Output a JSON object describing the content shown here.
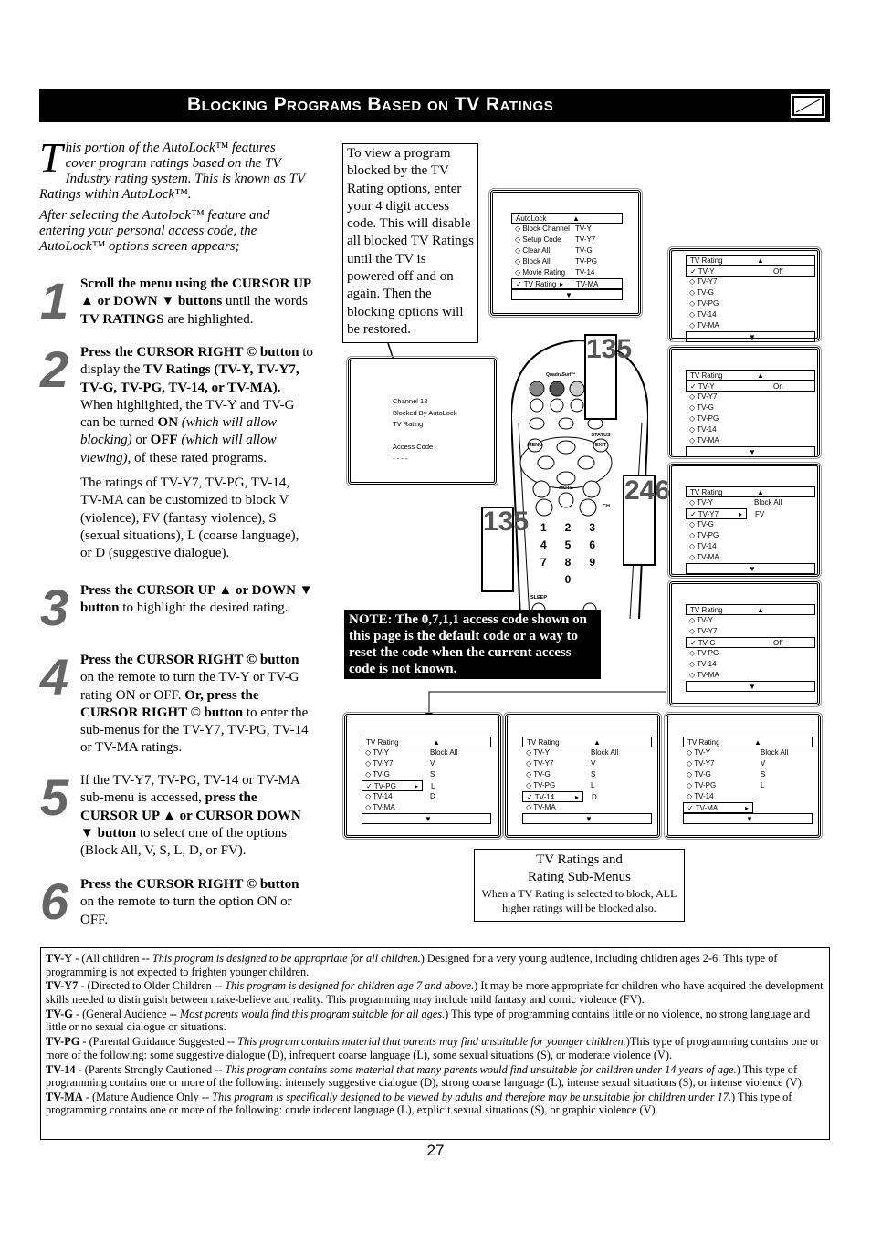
{
  "header": {
    "title": "Blocking Programs Based on TV Ratings",
    "icon": "tv-screen-icon"
  },
  "intro": {
    "dropcap": "T",
    "p1": "his portion of the AutoLock™ features cover program ratings based on the TV Industry rating system. This is known as TV Ratings within AutoLock™.",
    "p2": "After selecting the Autolock™ feature and entering your personal access code, the AutoLock™ options screen appears;"
  },
  "steps": [
    {
      "num": "1",
      "paras": [
        [
          {
            "t": "Scroll the menu using the CURSOR UP ▲ or DOWN ▼ buttons",
            "s": "b"
          },
          {
            "t": " until the words "
          },
          {
            "t": "TV RATINGS",
            "s": "b"
          },
          {
            "t": " are highlighted."
          }
        ]
      ]
    },
    {
      "num": "2",
      "paras": [
        [
          {
            "t": "Press the CURSOR RIGHT © but­ton",
            "s": "b"
          },
          {
            "t": " to display the "
          },
          {
            "t": "TV Ratings (TV-Y, TV-Y7, TV-G, TV-PG, TV-14, or TV-MA).",
            "s": "b"
          },
          {
            "t": " When highlighted, the TV-Y and TV-G can be turned "
          },
          {
            "t": "ON",
            "s": "b"
          },
          {
            "t": " (which will allow blocking)",
            "s": "i"
          },
          {
            "t": " or "
          },
          {
            "t": "OFF",
            "s": "b"
          },
          {
            "t": " (which will allow viewing)",
            "s": "i"
          },
          {
            "t": ", of these rated pro­grams."
          }
        ],
        [
          {
            "t": "The ratings of TV-Y7, TV-PG, TV-14, TV-MA can be customized to block V (violence), FV (fantasy violence), S (sexual situations), L (coarse lan­guage), or D (suggestive dialogue)."
          }
        ]
      ]
    },
    {
      "num": "3",
      "paras": [
        [
          {
            "t": "Press the CURSOR UP ▲ or DOWN ▼ button",
            "s": "b"
          },
          {
            "t": " to highlight the desired rat­ing."
          }
        ]
      ]
    },
    {
      "num": "4",
      "paras": [
        [
          {
            "t": "Press the CURSOR RIGHT © but­ton",
            "s": "b"
          },
          {
            "t": " on the remote to turn the TV-Y or TV-G rating ON or OFF. "
          },
          {
            "t": "Or, press the CURSOR RIGHT © button",
            "s": "b"
          },
          {
            "t": " to enter the sub-menus for the TV-Y7, TV-PG, TV-14 or TV-MA ratings."
          }
        ]
      ]
    },
    {
      "num": "5",
      "paras": [
        [
          {
            "t": "If the TV-Y7, TV-PG, TV-14 or TV-MA sub-menu is accessed, "
          },
          {
            "t": "press the CURSOR UP ▲ or CURSOR DOWN ▼ button",
            "s": "b"
          },
          {
            "t": " to select one of the options (Block All, V, S, L, D, or FV)."
          }
        ]
      ]
    },
    {
      "num": "6",
      "paras": [
        [
          {
            "t": "Press the CURSOR RIGHT © but­ton",
            "s": "b"
          },
          {
            "t": " on the remote to turn the option ON or OFF."
          }
        ]
      ]
    }
  ],
  "callout": "To view a program blocked by the TV Rating options, enter your 4 digit access code. This will dis­able all blocked TV Ratings until the TV is powered off and on again. Then the blocking options will be restored.",
  "blocked_screen": [
    "Channel 12",
    "Blocked By AutoLock",
    "TV Rating",
    "",
    "Access Code",
    "- - - -"
  ],
  "remote": {
    "brand": "QuadraSurf™",
    "buttons": [
      "MENU",
      "STATUS",
      "EXIT",
      "MUTE",
      "CH",
      "SLEEP"
    ],
    "digits": [
      "1",
      "2",
      "3",
      "4",
      "5",
      "6",
      "7",
      "8",
      "9",
      "0"
    ],
    "callouts": [
      "135",
      "246",
      "135"
    ]
  },
  "screens": [
    {
      "id": "autolock",
      "title": "AutoLock",
      "sel": 5,
      "rows": [
        [
          "Block Channel",
          "TV-Y"
        ],
        [
          "Setup Code",
          "TV-Y7"
        ],
        [
          "Clear All",
          "TV-G"
        ],
        [
          "Block All",
          "TV-PG"
        ],
        [
          "Movie Rating",
          "TV-14"
        ],
        [
          "TV Rating",
          "TV-MA"
        ]
      ]
    },
    {
      "id": "r1",
      "title": "TV Rating",
      "sel": 0,
      "rows": [
        [
          "TV-Y",
          "Off"
        ],
        [
          "TV-Y7",
          ""
        ],
        [
          "TV-G",
          ""
        ],
        [
          "TV-PG",
          ""
        ],
        [
          "TV-14",
          ""
        ],
        [
          "TV-MA",
          ""
        ]
      ]
    },
    {
      "id": "r2",
      "title": "TV Rating",
      "sel": 0,
      "rows": [
        [
          "TV-Y",
          "On"
        ],
        [
          "TV-Y7",
          ""
        ],
        [
          "TV-G",
          ""
        ],
        [
          "TV-PG",
          ""
        ],
        [
          "TV-14",
          ""
        ],
        [
          "TV-MA",
          ""
        ]
      ]
    },
    {
      "id": "r3",
      "title": "TV Rating",
      "sel": 1,
      "rows": [
        [
          "TV-Y",
          "Block All"
        ],
        [
          "TV-Y7",
          "FV"
        ],
        [
          "TV-G",
          ""
        ],
        [
          "TV-PG",
          ""
        ],
        [
          "TV-14",
          ""
        ],
        [
          "TV-MA",
          ""
        ]
      ]
    },
    {
      "id": "r4",
      "title": "TV Rating",
      "sel": 2,
      "rows": [
        [
          "TV-Y",
          ""
        ],
        [
          "TV-Y7",
          ""
        ],
        [
          "TV-G",
          "Off"
        ],
        [
          "TV-PG",
          ""
        ],
        [
          "TV-14",
          ""
        ],
        [
          "TV-MA",
          ""
        ]
      ]
    },
    {
      "id": "b1",
      "title": "TV Rating",
      "sel": 3,
      "rows": [
        [
          "TV-Y",
          "Block All"
        ],
        [
          "TV-Y7",
          "V"
        ],
        [
          "TV-G",
          "S"
        ],
        [
          "TV-PG",
          "L"
        ],
        [
          "TV-14",
          "D"
        ],
        [
          "TV-MA",
          ""
        ]
      ]
    },
    {
      "id": "b2",
      "title": "TV Rating",
      "sel": 4,
      "rows": [
        [
          "TV-Y",
          "Block All"
        ],
        [
          "TV-Y7",
          "V"
        ],
        [
          "TV-G",
          "S"
        ],
        [
          "TV-PG",
          "L"
        ],
        [
          "TV-14",
          "D"
        ],
        [
          "TV-MA",
          ""
        ]
      ]
    },
    {
      "id": "b3",
      "title": "TV Rating",
      "sel": 5,
      "rows": [
        [
          "TV-Y",
          "Block All"
        ],
        [
          "TV-Y7",
          "V"
        ],
        [
          "TV-G",
          "S"
        ],
        [
          "TV-PG",
          "L"
        ],
        [
          "TV-14",
          ""
        ],
        [
          "TV-MA",
          ""
        ]
      ]
    }
  ],
  "note": "NOTE: The 0,7,1,1 access code shown on this page is the default code or a way to reset the code when the current access code is not known.",
  "caption": {
    "title1": "TV Ratings and",
    "title2": "Rating Sub-Menus",
    "sub": "When a TV Rating is selected to block, ALL higher ratings will be blocked also."
  },
  "definitions": [
    [
      {
        "t": "TV-Y",
        "s": "b"
      },
      {
        "t": " - (All children -- "
      },
      {
        "t": "This program is designed to be appropriate for all children.",
        "s": "i"
      },
      {
        "t": ") Designed for a very young audience, including children ages 2-6. This type of programming is not expected to frighten younger children."
      }
    ],
    [
      {
        "t": "TV-Y7",
        "s": "b"
      },
      {
        "t": " - (Directed to Older Children -- "
      },
      {
        "t": "This program is designed for children age 7 and above.",
        "s": "i"
      },
      {
        "t": ") It may be more appropriate for children who have acquired the development skills needed to distinguish between make-believe and reality. This programming may include mild fantasy and comic violence (FV)."
      }
    ],
    [
      {
        "t": "TV-G",
        "s": "b"
      },
      {
        "t": " - (General Audience -- "
      },
      {
        "t": "Most parents would find this program suitable for all ages.",
        "s": "i"
      },
      {
        "t": ") This type of programming contains little or no violence, no strong language and little or no sexual dialogue or situations."
      }
    ],
    [
      {
        "t": "TV-PG",
        "s": "b"
      },
      {
        "t": " - (Parental Guidance Suggested -- "
      },
      {
        "t": "This program contains material that parents may find unsuitable for younger children.",
        "s": "i"
      },
      {
        "t": ")This type of programming contains one or more of the following: some suggestive dialogue (D), infrequent coarse language (L), some sexual situations (S), or moderate violence (V)."
      }
    ],
    [
      {
        "t": "TV-14",
        "s": "b"
      },
      {
        "t": " - (Parents Strongly Cautioned -- "
      },
      {
        "t": "This program contains some material that many parents would find unsuitable for children under 14 years of age.",
        "s": "i"
      },
      {
        "t": ") This type of programming contains one or more of the following: intensely suggestive dialogue (D), strong coarse language (L), intense sexual situations (S), or intense violence (V)."
      }
    ],
    [
      {
        "t": "TV-MA",
        "s": "b"
      },
      {
        "t": " - (Mature Audience Only -- "
      },
      {
        "t": "This program is specifically designed to be viewed by adults and therefore may be unsuitable for children under 17.",
        "s": "i"
      },
      {
        "t": ") This type of programming contains one or more of the following: crude indecent language (L), explicit sexual situations (S), or graphic violence (V)."
      }
    ]
  ],
  "page_number": "27"
}
